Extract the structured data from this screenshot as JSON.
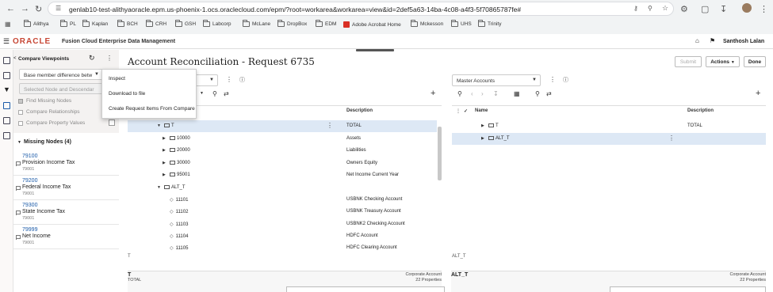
{
  "browser": {
    "url": "genlab10-test-alithyaoracle.epm.us-phoenix-1.ocs.oraclecloud.com/epm/?root=workarea&workarea=view&id=2def5a63-14ba-4c08-a4f3-5f70865787fe#",
    "bookmarks": [
      "Alithya",
      "PL",
      "Kaplan",
      "BCH",
      "CRH",
      "GSH",
      "Labcorp",
      "McLane",
      "DropBox",
      "EDM",
      "Adobe Acrobat Home",
      "Mckesson",
      "UHS",
      "Trinity"
    ]
  },
  "app": {
    "logo": "ORACLE",
    "product": "Fusion Cloud Enterprise Data Management",
    "user": "Santhosh Lalan"
  },
  "left_panel": {
    "title": "Compare Viewpoints",
    "compare_select": "Base member difference betw",
    "node_select_placeholder": "Selected Node and Descendar",
    "options": [
      {
        "label": "Find Missing Nodes",
        "checked": true
      },
      {
        "label": "Compare Relationships",
        "checked": false
      },
      {
        "label": "Compare Property Values",
        "checked": false
      }
    ],
    "missing_title": "Missing Nodes (4)",
    "missing_nodes": [
      {
        "code": "79100",
        "name": "Provision Income Tax",
        "sub": "79001"
      },
      {
        "code": "79200",
        "name": "Federal Income Tax",
        "sub": "79001"
      },
      {
        "code": "79300",
        "name": "State Income Tax",
        "sub": "79001"
      },
      {
        "code": "79999",
        "name": "Net Income",
        "sub": "79001"
      }
    ]
  },
  "menu": {
    "items": [
      "Inspect",
      "Download to file",
      "Create Request Items From Compare"
    ]
  },
  "main": {
    "title": "Account Reconciliation - Request 6735",
    "submit": "Submit",
    "actions": "Actions",
    "done": "Done"
  },
  "left_pane": {
    "description_header": "Description",
    "rows": [
      {
        "label": "T",
        "desc": "TOTAL"
      },
      {
        "label": "10000",
        "desc": "Assets"
      },
      {
        "label": "20000",
        "desc": "Liabilities"
      },
      {
        "label": "30000",
        "desc": "Owners Equity"
      },
      {
        "label": "95001",
        "desc": "Net Income Current Year"
      },
      {
        "label": "ALT_T",
        "desc": ""
      },
      {
        "label": "11101",
        "desc": "USBNK Checking Account"
      },
      {
        "label": "11102",
        "desc": "USBNK Treasury Account"
      },
      {
        "label": "11103",
        "desc": "USBNK2 Checking Account"
      },
      {
        "label": "11104",
        "desc": "HDFC Account"
      },
      {
        "label": "11105",
        "desc": "HDFC Clearing Account"
      }
    ],
    "path": "T",
    "footer_name": "T",
    "footer_sub": "TOTAL",
    "footer_right1": "Corporate Account",
    "footer_right2": "22 Properties"
  },
  "right_pane": {
    "viewpoint": "Master Accounts",
    "name_header": "Name",
    "description_header": "Description",
    "rows": [
      {
        "label": "T",
        "desc": "TOTAL"
      },
      {
        "label": "ALT_T",
        "desc": ""
      }
    ],
    "path": "ALT_T",
    "footer_name": "ALT_T",
    "footer_right1": "Corporate Account",
    "footer_right2": "22 Properties"
  }
}
